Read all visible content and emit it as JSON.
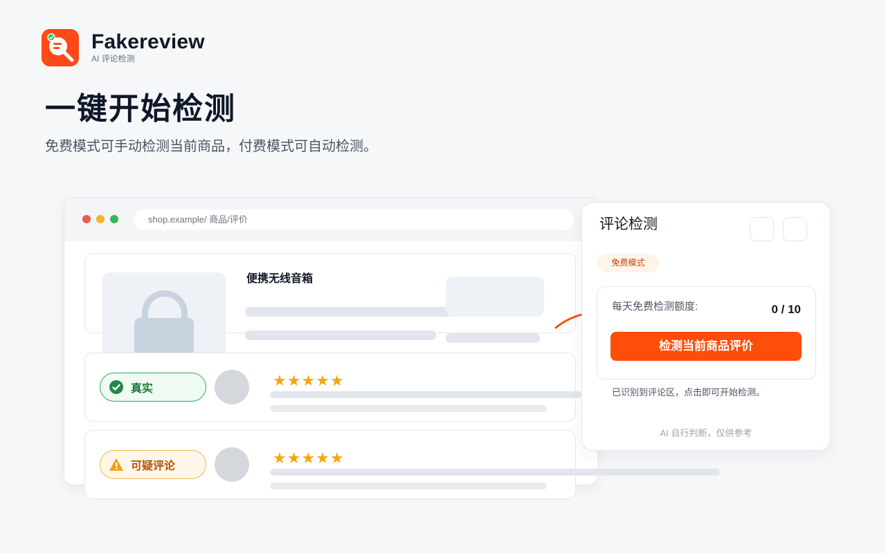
{
  "brand": {
    "name": "Fakereview",
    "subtitle": "AI 评论检测",
    "accent": "#ff4a17"
  },
  "hero": {
    "title": "一键开始检测",
    "subtitle": "免费模式可手动检测当前商品，付费模式可自动检测。"
  },
  "browser": {
    "url": "shop.example/ 商品/评价"
  },
  "product": {
    "name": "便携无线音箱"
  },
  "reviews": [
    {
      "badge": "真实",
      "status": "genuine",
      "stars": "★★★★★",
      "rating": 5
    },
    {
      "badge": "可疑评论",
      "status": "suspicious",
      "stars": "★★★★★",
      "rating": 5
    }
  ],
  "panel": {
    "title": "评论检测",
    "mode": "免费模式",
    "quota_label": "每天免费检测额度:",
    "quota_value": "0 / 10",
    "check_button": "检测当前商品评价",
    "hint": "已识别到评论区，点击即可开始检测。",
    "disclaimer": "AI 自行判断，仅供参考"
  },
  "colors": {
    "primary": "#ff4d0a",
    "genuine": "#38a85a",
    "suspicious": "#f5a609"
  }
}
